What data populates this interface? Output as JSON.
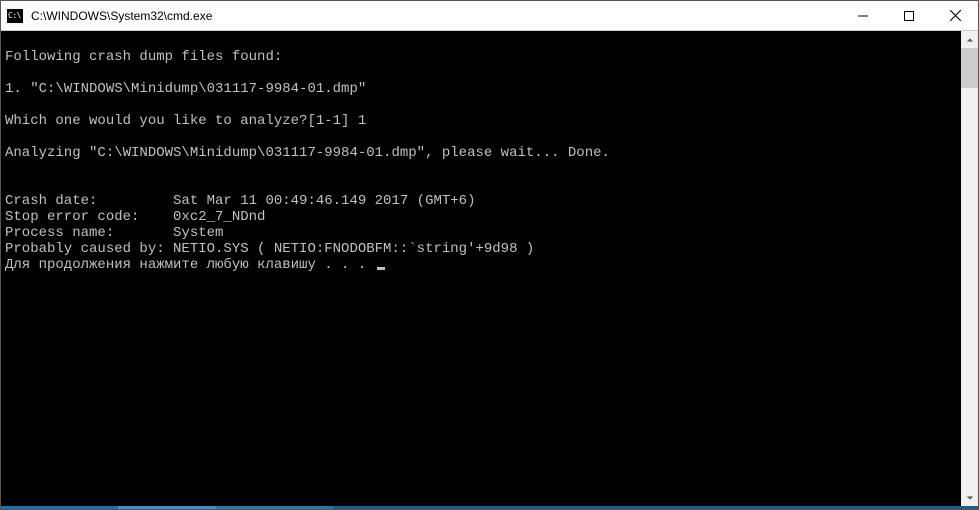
{
  "window": {
    "title": "C:\\WINDOWS\\System32\\cmd.exe"
  },
  "console": {
    "lines": [
      "",
      "Following crash dump files found:",
      "",
      "1. \"C:\\WINDOWS\\Minidump\\031117-9984-01.dmp\"",
      "",
      "Which one would you like to analyze?[1-1] 1",
      "",
      "Analyzing \"C:\\WINDOWS\\Minidump\\031117-9984-01.dmp\", please wait... Done.",
      "",
      "",
      "Crash date:         Sat Mar 11 00:49:46.149 2017 (GMT+6)",
      "Stop error code:    0xc2_7_NDnd",
      "Process name:       System",
      "Probably caused by: NETIO.SYS ( NETIO:FNODOBFM::`string'+9d98 )"
    ],
    "prompt_line": "Для продолжения нажмите любую клавишу . . . "
  }
}
